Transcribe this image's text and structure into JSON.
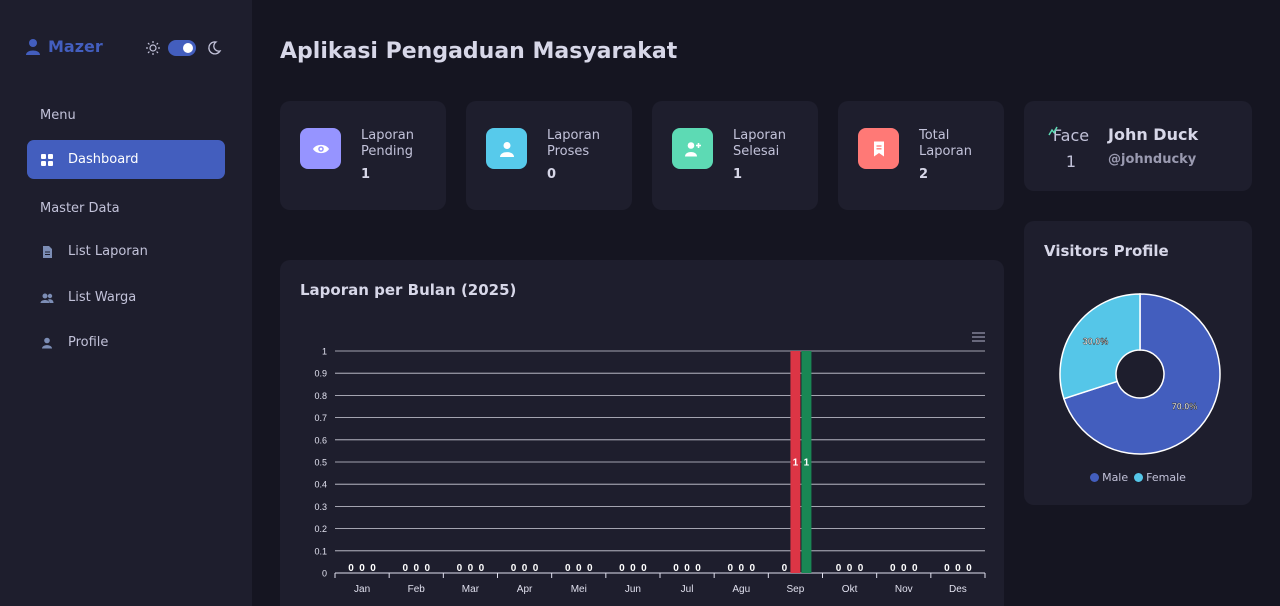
{
  "sidebar": {
    "brand": "Mazer",
    "menu_title": "Menu",
    "master_title": "Master Data",
    "items": [
      {
        "label": "Dashboard",
        "icon": "grid-icon"
      },
      {
        "label": "List Laporan",
        "icon": "document-icon"
      },
      {
        "label": "List Warga",
        "icon": "people-icon"
      },
      {
        "label": "Profile",
        "icon": "person-icon"
      }
    ]
  },
  "page": {
    "title": "Aplikasi Pengaduan Masyarakat"
  },
  "stats": [
    {
      "label": "Laporan Pending",
      "value": "1",
      "color": "#9694ff",
      "icon": "eye-icon"
    },
    {
      "label": "Laporan Proses",
      "value": "0",
      "color": "#57caeb",
      "icon": "person-icon"
    },
    {
      "label": "Laporan Selesai",
      "value": "1",
      "color": "#5ddab4",
      "icon": "person-add-icon"
    },
    {
      "label": "Total Laporan",
      "value": "2",
      "color": "#ff7976",
      "icon": "bookmark-icon"
    }
  ],
  "user": {
    "avatar_alt": "Face 1",
    "name": "John Duck",
    "handle": "@johnducky"
  },
  "chart_data": [
    {
      "type": "bar",
      "title": "Laporan per Bulan (2025)",
      "categories": [
        "Jan",
        "Feb",
        "Mar",
        "Apr",
        "Mei",
        "Jun",
        "Jul",
        "Agu",
        "Sep",
        "Okt",
        "Nov",
        "Des"
      ],
      "series": [
        {
          "values": [
            0,
            0,
            0,
            0,
            0,
            0,
            0,
            0,
            0,
            0,
            0,
            0
          ]
        },
        {
          "values": [
            0,
            0,
            0,
            0,
            0,
            0,
            0,
            0,
            1,
            0,
            0,
            0
          ]
        },
        {
          "values": [
            0,
            0,
            0,
            0,
            0,
            0,
            0,
            0,
            1,
            0,
            0,
            0
          ]
        }
      ],
      "series_colors": [
        "#435ebe",
        "#dc3545",
        "#198754"
      ],
      "ylim": [
        0,
        1
      ],
      "yticks": [
        "0",
        "0.1",
        "0.2",
        "0.3",
        "0.4",
        "0.5",
        "0.6",
        "0.7",
        "0.8",
        "0.9",
        "1"
      ],
      "grid": true
    },
    {
      "type": "pie",
      "title": "Visitors Profile",
      "labels": [
        "Male",
        "Female"
      ],
      "values": [
        70,
        30
      ],
      "value_labels": [
        "70.0%",
        "30.0%"
      ],
      "colors": [
        "#435ebe",
        "#55c6e8"
      ],
      "legend": "bottom"
    }
  ]
}
